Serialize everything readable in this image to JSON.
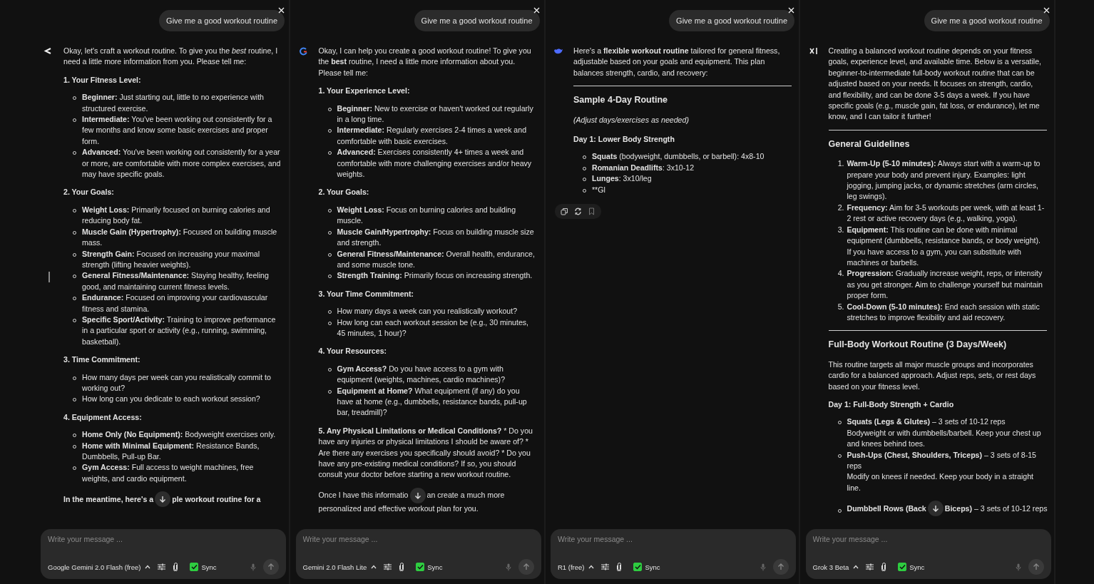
{
  "panes": [
    {
      "prompt": "Give me a good workout routine",
      "avatar": {
        "kind": "chevron"
      },
      "blocks": [
        {
          "kind": "para",
          "rich": "Okay, let's craft a workout routine. To give you the *best* routine, I need a little more information from you. Please tell me:"
        },
        {
          "kind": "sub",
          "text": "1. Your Fitness Level:"
        },
        {
          "kind": "bullets",
          "items": [
            {
              "lead": "Beginner:",
              "text": " Just starting out, little to no experience with structured exercise."
            },
            {
              "lead": "Intermediate:",
              "text": " You've been working out consistently for a few months and know some basic exercises and proper form."
            },
            {
              "lead": "Advanced:",
              "text": " You've been working out consistently for a year or more, are comfortable with more complex exercises, and may have specific goals."
            }
          ]
        },
        {
          "kind": "sub",
          "text": "2. Your Goals:"
        },
        {
          "kind": "bullets",
          "items": [
            {
              "lead": "Weight Loss:",
              "text": " Primarily focused on burning calories and reducing body fat."
            },
            {
              "lead": "Muscle Gain (Hypertrophy):",
              "text": " Focused on building muscle mass."
            },
            {
              "lead": "Strength Gain:",
              "text": " Focused on increasing your maximal strength (lifting heavier weights)."
            },
            {
              "lead": "General Fitness/Maintenance:",
              "text": " Staying healthy, feeling good, and maintaining current fitness levels."
            },
            {
              "lead": "Endurance:",
              "text": " Focused on improving your cardiovascular fitness and stamina."
            },
            {
              "lead": "Specific Sport/Activity:",
              "text": " Training to improve performance in a particular sport or activity (e.g., running, swimming, basketball)."
            }
          ]
        },
        {
          "kind": "sub",
          "text": "3. Time Commitment:"
        },
        {
          "kind": "bullets",
          "items": [
            {
              "text": "How many days per week can you realistically commit to working out?"
            },
            {
              "text": "How long can you dedicate to each workout session?"
            }
          ]
        },
        {
          "kind": "sub",
          "text": "4. Equipment Access:"
        },
        {
          "kind": "bullets",
          "items": [
            {
              "lead": "Home Only (No Equipment):",
              "text": " Bodyweight exercises only."
            },
            {
              "lead": "Home with Minimal Equipment:",
              "text": " Resistance Bands, Dumbbells, Pull-up Bar."
            },
            {
              "lead": "Gym Access:",
              "text": " Full access to weight machines, free weights, and cardio equipment."
            }
          ]
        },
        {
          "kind": "cutline",
          "bold": true,
          "before": "In the meantime, here's a",
          "after": "ple workout routine for a"
        }
      ],
      "composer": {
        "placeholder": "Write your message ...",
        "model": "Google Gemini 2.0 Flash (free)",
        "sync": {
          "label": "Sync",
          "checked": true
        }
      }
    },
    {
      "prompt": "Give me a good workout routine",
      "avatar": {
        "kind": "arc"
      },
      "blocks": [
        {
          "kind": "para",
          "rich": "Okay, I can help you create a good workout routine! To give you the **best** routine, I need a little more information about you. Please tell me:"
        },
        {
          "kind": "sub",
          "text": "1. Your Experience Level:"
        },
        {
          "kind": "bullets",
          "items": [
            {
              "lead": "Beginner:",
              "text": " New to exercise or haven't worked out regularly in a long time."
            },
            {
              "lead": "Intermediate:",
              "text": " Regularly exercises 2-4 times a week and comfortable with basic exercises."
            },
            {
              "lead": "Advanced:",
              "text": " Exercises consistently 4+ times a week and comfortable with more challenging exercises and/or heavy weights."
            }
          ]
        },
        {
          "kind": "sub",
          "text": "2. Your Goals:"
        },
        {
          "kind": "bullets",
          "items": [
            {
              "lead": "Weight Loss:",
              "text": " Focus on burning calories and building muscle."
            },
            {
              "lead": "Muscle Gain/Hypertrophy:",
              "text": " Focus on building muscle size and strength."
            },
            {
              "lead": "General Fitness/Maintenance:",
              "text": " Overall health, endurance, and some muscle tone."
            },
            {
              "lead": "Strength Training:",
              "text": " Primarily focus on increasing strength."
            }
          ]
        },
        {
          "kind": "sub",
          "text": "3. Your Time Commitment:"
        },
        {
          "kind": "bullets",
          "items": [
            {
              "text": "How many days a week can you realistically workout?"
            },
            {
              "text": "How long can each workout session be (e.g., 30 minutes, 45 minutes, 1 hour)?"
            }
          ]
        },
        {
          "kind": "sub",
          "text": "4. Your Resources:"
        },
        {
          "kind": "bullets",
          "items": [
            {
              "lead": "Gym Access?",
              "text": " Do you have access to a gym with equipment (weights, machines, cardio machines)?"
            },
            {
              "lead": "Equipment at Home?",
              "text": " What equipment (if any) do you have at home (e.g., dumbbells, resistance bands, pull-up bar, treadmill)?"
            }
          ]
        },
        {
          "kind": "para",
          "lead": "5. Any Physical Limitations or Medical Conditions?",
          "text": " * Do you have any injuries or physical limitations I should be aware of? * Are there any exercises you specifically should avoid? * Do you have any pre-existing medical conditions? If so, you should consult your doctor before starting a new workout routine."
        },
        {
          "kind": "cutline",
          "before": "Once I have this informatio",
          "after": "an create a much more",
          "rest": "personalized and effective workout plan for you."
        }
      ],
      "composer": {
        "placeholder": "Write your message ...",
        "model": "Gemini 2.0 Flash Lite",
        "sync": {
          "label": "Sync",
          "checked": true
        }
      }
    },
    {
      "prompt": "Give me a good workout routine",
      "avatar": {
        "kind": "whale"
      },
      "blocks": [
        {
          "kind": "para",
          "rich": "Here's a **flexible workout routine** tailored for general fitness, adjustable based on your goals and equipment. This plan balances strength, cardio, and recovery:"
        },
        {
          "kind": "rule"
        },
        {
          "kind": "heading",
          "text": "Sample 4-Day Routine"
        },
        {
          "kind": "note",
          "text": "(Adjust days/exercises as needed)"
        },
        {
          "kind": "sub",
          "text": "Day 1: Lower Body Strength"
        },
        {
          "kind": "bullets",
          "items": [
            {
              "lead": "Squats",
              "text": " (bodyweight, dumbbells, or barbell): 4x8-10"
            },
            {
              "lead": "Romanian Deadlifts",
              "text": ": 3x10-12"
            },
            {
              "lead": "Lunges",
              "text": ": 3x10/leg"
            },
            {
              "text": "**Gl"
            }
          ]
        },
        {
          "kind": "actions"
        }
      ],
      "composer": {
        "placeholder": "Write your message ...",
        "model": "R1 (free)",
        "sync": {
          "label": "Sync",
          "checked": true
        }
      }
    },
    {
      "prompt": "Give me a good workout routine",
      "avatar": {
        "kind": "slash"
      },
      "blocks": [
        {
          "kind": "para",
          "text": "Creating a balanced workout routine depends on your fitness goals, experience level, and available time. Below is a versatile, beginner-to-intermediate full-body workout routine that can be adjusted based on your needs. It focuses on strength, cardio, and flexibility, and can be done 3-5 days a week. If you have specific goals (e.g., muscle gain, fat loss, or endurance), let me know, and I can tailor it further!"
        },
        {
          "kind": "rule"
        },
        {
          "kind": "heading",
          "text": "General Guidelines"
        },
        {
          "kind": "numbered",
          "items": [
            {
              "number": "1.",
              "lead": "Warm-Up (5-10 minutes):",
              "text": " Always start with a warm-up to prepare your body and prevent injury. Examples: light jogging, jumping jacks, or dynamic stretches (arm circles, leg swings)."
            },
            {
              "number": "2.",
              "lead": "Frequency:",
              "text": " Aim for 3-5 workouts per week, with at least 1-2 rest or active recovery days (e.g., walking, yoga)."
            },
            {
              "number": "3.",
              "lead": "Equipment:",
              "text": " This routine can be done with minimal equipment (dumbbells, resistance bands, or body weight). If you have access to a gym, you can substitute with machines or barbells."
            },
            {
              "number": "4.",
              "lead": "Progression:",
              "text": " Gradually increase weight, reps, or intensity as you get stronger. Aim to challenge yourself but maintain proper form."
            },
            {
              "number": "5.",
              "lead": "Cool-Down (5-10 minutes):",
              "text": " End each session with static stretches to improve flexibility and aid recovery."
            }
          ]
        },
        {
          "kind": "rule"
        },
        {
          "kind": "heading",
          "text": "Full-Body Workout Routine (3 Days/Week)"
        },
        {
          "kind": "para",
          "text": "This routine targets all major muscle groups and incorporates cardio for a balanced approach. Adjust reps, sets, or rest days based on your fitness level."
        },
        {
          "kind": "sub",
          "text": "Day 1: Full-Body Strength + Cardio"
        },
        {
          "kind": "bullets",
          "items": [
            {
              "lead": "Squats (Legs & Glutes)",
              "text": " – 3 sets of 10-12 reps",
              "note": "Bodyweight or with dumbbells/barbell. Keep your chest up and knees behind toes."
            },
            {
              "lead": "Push-Ups (Chest, Shoulders, Triceps)",
              "text": " – 3 sets of 8-15 reps",
              "note": "Modify on knees if needed. Keep your body in a straight line."
            }
          ]
        },
        {
          "kind": "cutline",
          "bullet": true,
          "lead": "Dumbbell Rows (Back",
          "after_lead": "Biceps)",
          "after": " – 3 sets of 10-12 reps"
        }
      ],
      "composer": {
        "placeholder": "Write your message ...",
        "model": "Grok 3 Beta",
        "sync": {
          "label": "Sync",
          "checked": true
        }
      }
    }
  ]
}
